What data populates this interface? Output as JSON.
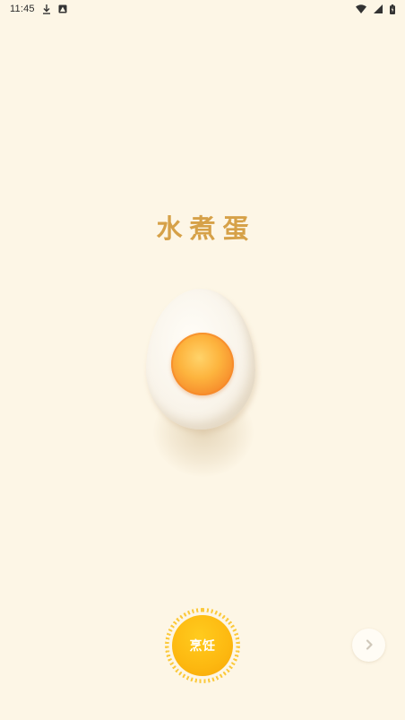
{
  "status_bar": {
    "time": "11:45",
    "left_icons": [
      "download-icon",
      "image-notification-icon"
    ],
    "right_icons": [
      "wifi-icon",
      "signal-icon",
      "battery-icon"
    ]
  },
  "main": {
    "title": "水煮蛋",
    "egg_illustration": "boiled-egg-half-icon"
  },
  "controls": {
    "cook_label": "烹饪",
    "next_icon": "chevron-right-icon"
  },
  "colors": {
    "background": "#FDF6E6",
    "title": "#D6A148",
    "cook_button": "#FDB810",
    "yolk": "#F6892A"
  }
}
